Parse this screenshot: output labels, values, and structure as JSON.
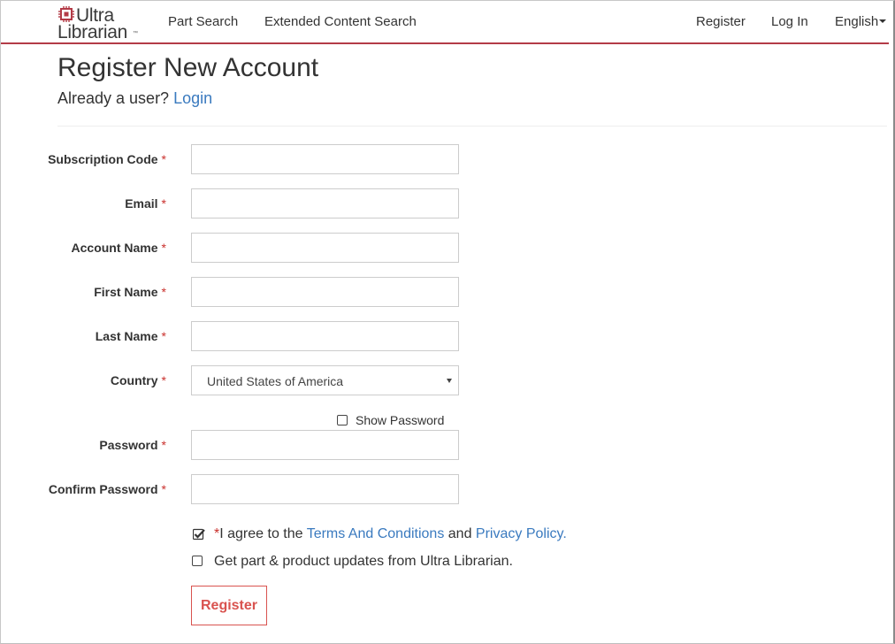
{
  "brand": {
    "logo_line1": "Ultra",
    "logo_line2": "Librarian",
    "logo_tm": "™",
    "accent_color": "#b33b47"
  },
  "nav": {
    "left_links": [
      "Part Search",
      "Extended Content Search"
    ],
    "right_links": [
      "Register",
      "Log In"
    ],
    "language": "English"
  },
  "header": {
    "title": "Register New Account",
    "already_user_text": "Already a user?",
    "login_link": "Login"
  },
  "form": {
    "required_marker": "*",
    "fields": [
      {
        "label": "Subscription Code",
        "value": ""
      },
      {
        "label": "Email",
        "value": ""
      },
      {
        "label": "Account Name",
        "value": ""
      },
      {
        "label": "First Name",
        "value": ""
      },
      {
        "label": "Last Name",
        "value": ""
      }
    ],
    "country": {
      "label": "Country",
      "value": "United States of America"
    },
    "show_password": {
      "label": "Show Password",
      "checked": false
    },
    "password": {
      "label": "Password",
      "value": ""
    },
    "confirm_password": {
      "label": "Confirm Password",
      "value": ""
    },
    "agree": {
      "checked": true,
      "prefix": "I agree to the ",
      "terms_link": "Terms And Conditions",
      "middle": " and ",
      "privacy_link": "Privacy Policy",
      "suffix": "."
    },
    "updates": {
      "checked": false,
      "label": "Get part & product updates from Ultra Librarian."
    },
    "submit_label": "Register"
  },
  "colors": {
    "link": "#3a7abf",
    "required": "#c9302c",
    "register_button": "#d9534f"
  },
  "icons": {
    "logo": "chip-icon",
    "dropdown": "caret-down-icon",
    "checkmark": "check-icon"
  }
}
